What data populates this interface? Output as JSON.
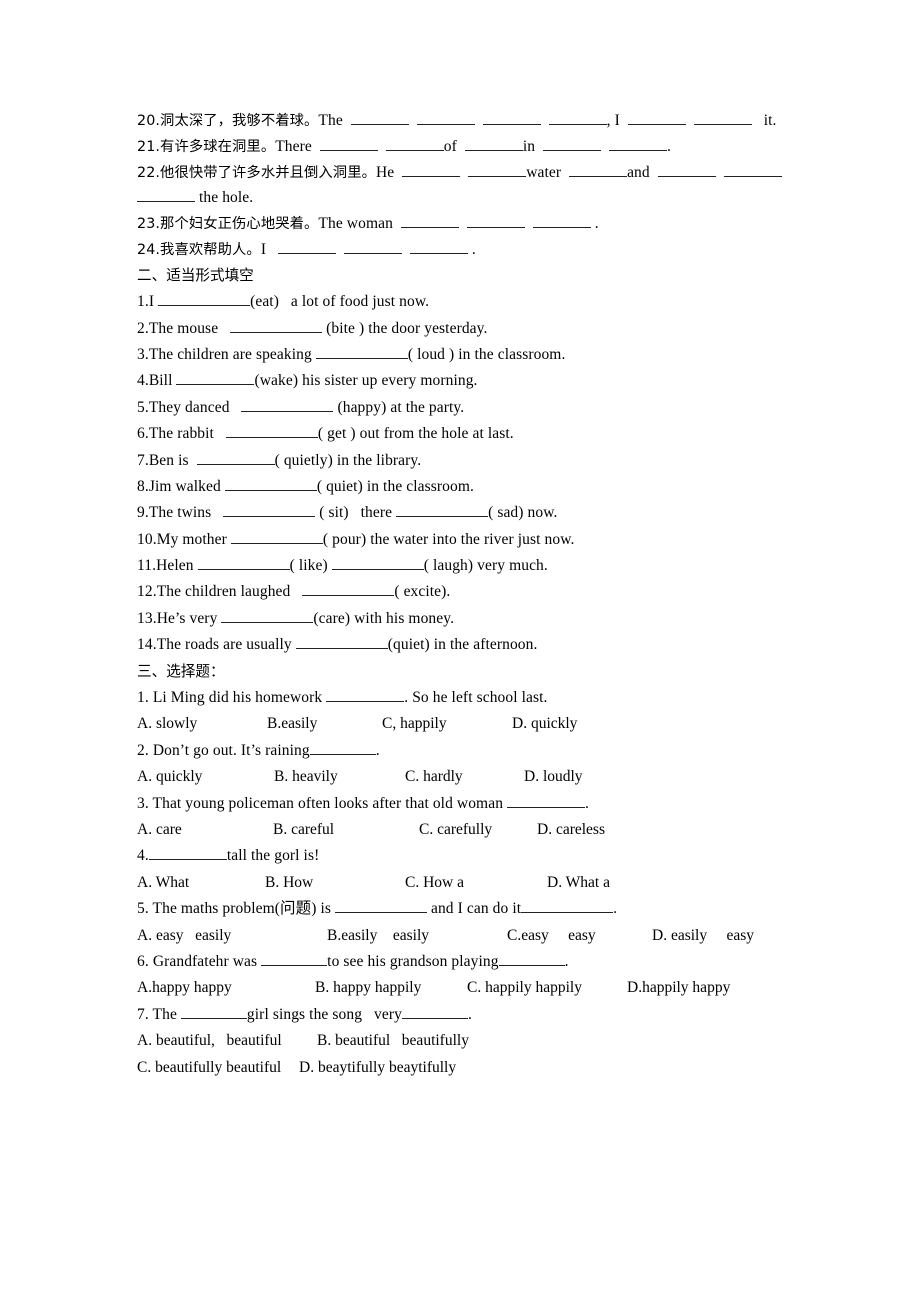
{
  "document": {
    "type": "english-grammar-worksheet",
    "language_mix": "Chinese-English"
  },
  "section_translate": {
    "items": [
      {
        "number": "20.",
        "chinese": "洞太深了，我够不着球。",
        "english_before": "The",
        "trailing": "it.",
        "blanks": 6,
        "mid_text": ", I"
      },
      {
        "number": "21.",
        "chinese": "有许多球在洞里。",
        "english_before": "There",
        "parts": [
          "of",
          "in"
        ],
        "trailing": "."
      },
      {
        "number": "22.",
        "chinese": "他很快带了许多水并且倒入洞里。",
        "english_before": "He",
        "parts": [
          "water",
          "and"
        ],
        "wrap_text": "the hole."
      },
      {
        "number": "23.",
        "chinese": "那个妇女正伤心地哭着。",
        "english_before": "The woman",
        "trailing": "."
      },
      {
        "number": "24.",
        "chinese": "我喜欢帮助人。",
        "english_before": "I",
        "trailing": "."
      }
    ]
  },
  "section_two": {
    "heading": "二、适当形式填空",
    "items": [
      {
        "num": "1.",
        "pre": "I",
        "hint": "(eat)",
        "post": "a lot of food just now."
      },
      {
        "num": "2.",
        "pre": "The mouse",
        "hint": "(bite )",
        "post": "the door yesterday."
      },
      {
        "num": "3.",
        "pre": "The children are speaking",
        "hint": "( loud )",
        "post": "in the classroom."
      },
      {
        "num": "4.",
        "pre": "Bill",
        "hint": "(wake)",
        "post": "his sister up every morning."
      },
      {
        "num": "5.",
        "pre": "They danced",
        "hint": "(happy)",
        "post": "at the party."
      },
      {
        "num": "6.",
        "pre": "The rabbit",
        "hint": "( get )",
        "post": "out from the hole at last."
      },
      {
        "num": "7.",
        "pre": "Ben is",
        "hint": "( quietly)",
        "post": "in the library."
      },
      {
        "num": "8.",
        "pre": "Jim walked",
        "hint": "( quiet)",
        "post": "in the classroom."
      },
      {
        "num": "9.",
        "pre": "The twins",
        "hint": "( sit)",
        "mid": "there",
        "hint2": "( sad)",
        "post": "now."
      },
      {
        "num": "10.",
        "pre": "My mother",
        "hint": "( pour)",
        "post": "the water into the river just now."
      },
      {
        "num": "11.",
        "pre": "Helen",
        "hint": "( like)",
        "hint2": "( laugh)",
        "post": "very much."
      },
      {
        "num": "12.",
        "pre": "The children laughed",
        "hint": "( excite).",
        "post": ""
      },
      {
        "num": "13.",
        "pre": "He’s very",
        "hint": "(care)",
        "post": "with his money."
      },
      {
        "num": "14.",
        "pre": "The roads are usually",
        "hint": "(quiet)",
        "post": "in the afternoon."
      }
    ]
  },
  "section_three": {
    "heading": "三、选择题：",
    "questions": [
      {
        "stem_num": "1.",
        "stem_pre": "Li Ming did his homework",
        "stem_post": ". So he left school last.",
        "options": [
          "A. slowly",
          "B.easily",
          "C, happily",
          "D. quickly"
        ],
        "option_x": [
          0,
          130,
          245,
          375
        ]
      },
      {
        "stem_num": "2.",
        "stem_pre": "Don’t go out. It’s raining",
        "stem_post": ".",
        "options": [
          "A. quickly",
          "B. heavily",
          "C. hardly",
          "D. loudly"
        ],
        "option_x": [
          0,
          137,
          268,
          387
        ]
      },
      {
        "stem_num": "3.",
        "stem_pre": "That young policeman often looks after that old woman",
        "stem_post": ".",
        "options": [
          "A. care",
          "B. careful",
          "C. carefully",
          "D. careless"
        ],
        "option_x": [
          0,
          136,
          282,
          400
        ]
      },
      {
        "stem_num": "4.",
        "stem_pre": "",
        "stem_post": "tall the gorl is!",
        "options": [
          "A. What",
          "B. How",
          "C. How a",
          "D. What a"
        ],
        "option_x": [
          0,
          128,
          268,
          410
        ]
      },
      {
        "stem_num": "5.",
        "stem_pre": "The maths problem(问题) is",
        "stem_mid": "and I can do it",
        "stem_post": ".",
        "options": [
          "A. easy   easily",
          "B.easily    easily",
          "C.easy     easy",
          "D. easily     easy"
        ],
        "option_x": [
          0,
          190,
          370,
          515
        ]
      },
      {
        "stem_num": "6.",
        "stem_pre": "Grandfatehr was",
        "stem_mid": "to see his grandson playing",
        "stem_post": ".",
        "options": [
          "A.happy happy",
          "B. happy happily",
          "C. happily happily",
          "D.happily happy"
        ],
        "option_x": [
          0,
          178,
          330,
          490
        ]
      },
      {
        "stem_num": "7.",
        "stem_pre": "The",
        "stem_mid": "girl sings the song   very",
        "stem_post": ".",
        "options": [
          "A. beautiful,   beautiful",
          "B. beautiful   beautifully"
        ],
        "option_x": [
          0,
          180
        ],
        "options2": [
          "C. beautifully beautiful",
          "D. beaytifully beaytifully"
        ],
        "option2_x": [
          0,
          162
        ]
      }
    ]
  }
}
